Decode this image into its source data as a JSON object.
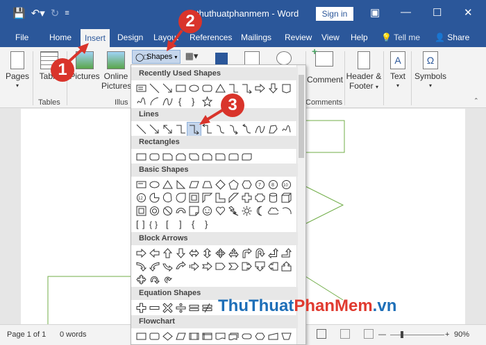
{
  "window": {
    "doc_title": "thuthuatphanmem - Word",
    "signin_label": "Sign in"
  },
  "tabs": [
    {
      "label": "File"
    },
    {
      "label": "Home"
    },
    {
      "label": "Insert"
    },
    {
      "label": "Design"
    },
    {
      "label": "Layout"
    },
    {
      "label": "References"
    },
    {
      "label": "Mailings"
    },
    {
      "label": "Review"
    },
    {
      "label": "View"
    },
    {
      "label": "Help"
    }
  ],
  "tell_me": "Tell me",
  "share_label": "Share",
  "ribbon": {
    "pages_label": "Pages",
    "table_label": "Table",
    "tables_group": "Tables",
    "pictures_label": "Pictures",
    "online_pictures_label1": "Online",
    "online_pictures_label2": "Pictures",
    "illus_group": "Illus",
    "shapes_label": "Shapes",
    "comment_label": "Comment",
    "comments_group": "Comments",
    "header_footer_label1": "Header &",
    "header_footer_label2": "Footer",
    "text_label": "Text",
    "symbols_label": "Symbols"
  },
  "dropdown": {
    "categories": {
      "recent": "Recently Used Shapes",
      "lines": "Lines",
      "rectangles": "Rectangles",
      "basic": "Basic Shapes",
      "block_arrows": "Block Arrows",
      "equation": "Equation Shapes",
      "flowchart": "Flowchart"
    }
  },
  "status": {
    "page": "Page 1 of 1",
    "words": "0 words",
    "zoom": "90%"
  },
  "annotations": {
    "step1": "1",
    "step2": "2",
    "step3": "3"
  },
  "watermark": {
    "part1": "ThuThuat",
    "part2": "PhanMem",
    "part3": ".vn"
  },
  "colors": {
    "title_bar": "#2b579a",
    "accent_red": "#d9342b",
    "shape_green": "#70ad47"
  }
}
